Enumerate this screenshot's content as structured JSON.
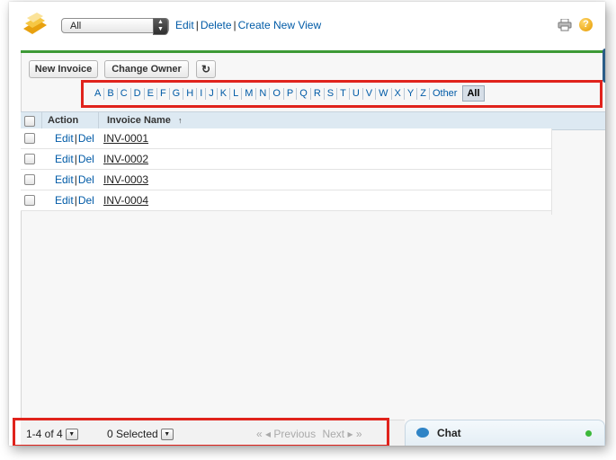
{
  "header": {
    "view_select_value": "All",
    "edit_link": "Edit",
    "delete_link": "Delete",
    "create_view_link": "Create New View",
    "separator": "|"
  },
  "toolbar": {
    "new_invoice_label": "New Invoice",
    "change_owner_label": "Change Owner",
    "refresh_icon": "refresh-icon"
  },
  "alpha_filter": {
    "letters": [
      "A",
      "B",
      "C",
      "D",
      "E",
      "F",
      "G",
      "H",
      "I",
      "J",
      "K",
      "L",
      "M",
      "N",
      "O",
      "P",
      "Q",
      "R",
      "S",
      "T",
      "U",
      "V",
      "W",
      "X",
      "Y",
      "Z",
      "Other"
    ],
    "selected": "All"
  },
  "grid": {
    "columns": {
      "action": "Action",
      "invoice_name": "Invoice Name",
      "sort_indicator": "↑"
    },
    "rows": [
      {
        "edit": "Edit",
        "del": "Del",
        "name": "INV-0001"
      },
      {
        "edit": "Edit",
        "del": "Del",
        "name": "INV-0002"
      },
      {
        "edit": "Edit",
        "del": "Del",
        "name": "INV-0003"
      },
      {
        "edit": "Edit",
        "del": "Del",
        "name": "INV-0004"
      }
    ]
  },
  "footer": {
    "record_count": "1-4 of 4",
    "selected_count": "0 Selected",
    "first_icon": "«",
    "prev_icon": "◂",
    "previous_label": "Previous",
    "next_label": "Next",
    "next_icon": "▸",
    "last_icon": "»"
  },
  "chat": {
    "label": "Chat",
    "status_color": "#3cb83a"
  },
  "colors": {
    "link": "#015ba7",
    "accent_green": "#3d9a36",
    "highlight_red": "#e0231c",
    "grid_header": "#dde9f2"
  }
}
